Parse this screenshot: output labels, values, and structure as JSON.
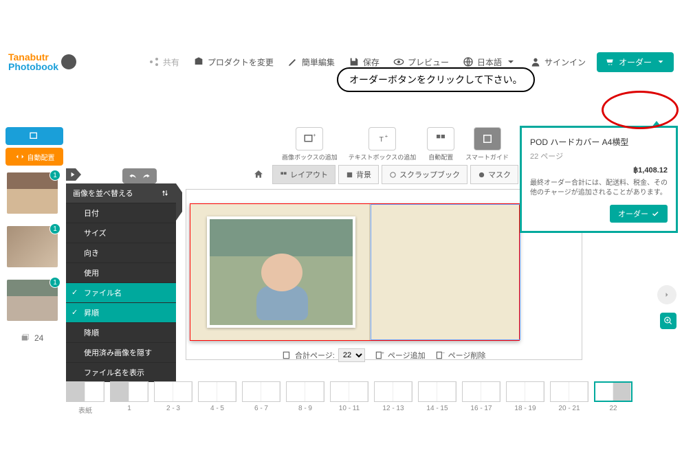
{
  "annotation": {
    "callout": "オーダーボタンをクリックして下さい。"
  },
  "logo": {
    "t": "Tanabutr",
    "p": "Photobook"
  },
  "header": {
    "share": "共有",
    "change_product": "プロダクトを変更",
    "easy_edit": "簡単編集",
    "save": "保存",
    "preview": "プレビュー",
    "language": "日本語",
    "signin": "サインイン",
    "order": "オーダー"
  },
  "actions": {
    "auto_layout": "自動配置"
  },
  "toolbar": {
    "add_image_box": "画像ボックスの追加",
    "add_text_box": "テキストボックスの追加",
    "auto_layout": "自動配置",
    "smart_guide": "スマートガイド"
  },
  "tabs": {
    "layout": "レイアウト",
    "bg": "背景",
    "scrap": "スクラップブック",
    "mask": "マスク"
  },
  "sort": {
    "header": "画像を並べ替える",
    "date": "日付",
    "size": "サイズ",
    "orient": "向き",
    "usage": "使用",
    "filename": "ファイル名",
    "asc": "昇順",
    "desc": "降順",
    "hide_used": "使用済み画像を隠す",
    "show_filename": "ファイル名を表示"
  },
  "thumbs": {
    "count": "24"
  },
  "pagebar": {
    "total": "合計ページ:",
    "selected": "22",
    "add": "ページ追加",
    "del": "ページ削除"
  },
  "filmstrip": [
    "表紙",
    "1",
    "2 - 3",
    "4 - 5",
    "6 - 7",
    "8 - 9",
    "10 - 11",
    "12 - 13",
    "14 - 15",
    "16 - 17",
    "18 - 19",
    "20 - 21",
    "22"
  ],
  "order_popup": {
    "title": "POD ハードカバー A4横型",
    "pages": "22 ページ",
    "price": "฿1,408.12",
    "note": "最終オーダー合計には、配送料、税金、その他のチャージが追加されることがあります。",
    "btn": "オーダー"
  }
}
